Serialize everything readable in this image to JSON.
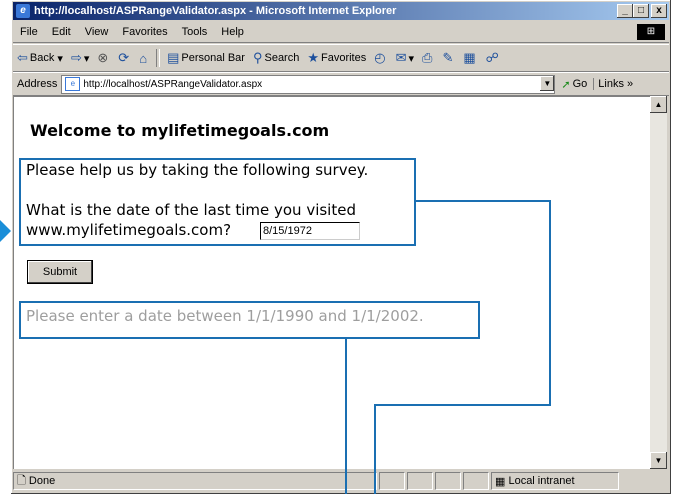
{
  "window": {
    "title": "http://localhost/ASPRangeValidator.aspx - Microsoft Internet Explorer",
    "controls": [
      "_",
      "□",
      "x"
    ]
  },
  "menu": [
    "File",
    "Edit",
    "View",
    "Favorites",
    "Tools",
    "Help"
  ],
  "toolbar": {
    "back": "Back",
    "personal_bar": "Personal Bar",
    "search": "Search",
    "favorites": "Favorites"
  },
  "address": {
    "label": "Address",
    "url": "http://localhost/ASPRangeValidator.aspx",
    "go": "Go",
    "links": "Links"
  },
  "page": {
    "heading": "Welcome to mylifetimegoals.com",
    "intro": "Please help us by taking the following survey.",
    "question_line1": "What is the date of the last time you visited",
    "question_line2": "www.mylifetimegoals.com?",
    "date_value": "8/15/1972",
    "submit_label": "Submit",
    "error_message": "Please enter a date between 1/1/1990 and 1/1/2002."
  },
  "status": {
    "text": "Done",
    "zone": "Local intranet"
  },
  "colors": {
    "callout": "#1a6fb2",
    "pointer": "#1a8ed8",
    "error_text": "#9e9e9e"
  }
}
